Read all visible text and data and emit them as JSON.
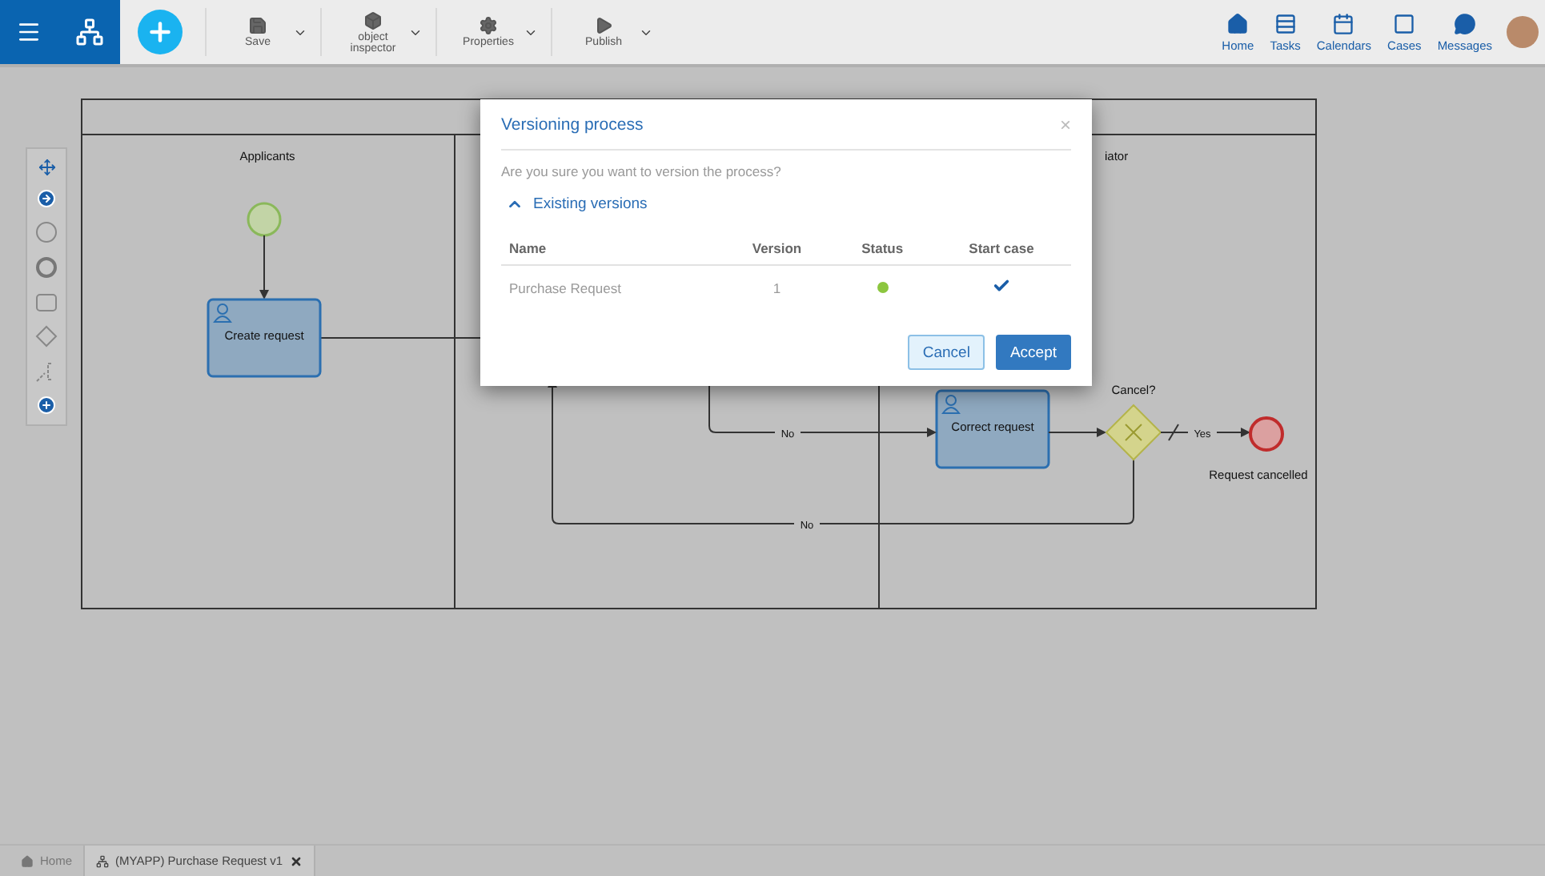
{
  "toolbar": [
    {
      "label": "Save",
      "kind": "save"
    },
    {
      "label": "object inspector",
      "kind": "inspector"
    },
    {
      "label": "Properties",
      "kind": "properties"
    },
    {
      "label": "Publish",
      "kind": "publish"
    }
  ],
  "nav": [
    {
      "label": "Home",
      "kind": "home"
    },
    {
      "label": "Tasks",
      "kind": "tasks"
    },
    {
      "label": "Calendars",
      "kind": "calendars"
    },
    {
      "label": "Cases",
      "kind": "cases"
    },
    {
      "label": "Messages",
      "kind": "messages"
    }
  ],
  "diagram": {
    "lanes": [
      "Applicants",
      "iator"
    ],
    "tasks": [
      "Create request",
      "Correct request"
    ],
    "gateway": "Cancel?",
    "end_event": "Request cancelled",
    "flow_labels": [
      "No",
      "Yes",
      "No"
    ]
  },
  "dialog": {
    "title": "Versioning process",
    "close": "×",
    "question": "Are you sure you want to version the process?",
    "section": {
      "label": "Existing versions",
      "expanded": true
    },
    "columns": [
      "Name",
      "Version",
      "Status",
      "Start case"
    ],
    "rows": [
      {
        "name": "Purchase Request",
        "version": "1",
        "color": "#8cc63f",
        "start_case": true
      }
    ],
    "buttons": [
      {
        "label": "Cancel",
        "kind": "secondary"
      },
      {
        "label": "Accept",
        "kind": "primary"
      }
    ]
  },
  "tabs": [
    {
      "label": "Home",
      "kind": "home",
      "selected": false
    },
    {
      "label": "(MYAPP) Purchase Request v1",
      "kind": "process",
      "selected": true
    }
  ]
}
